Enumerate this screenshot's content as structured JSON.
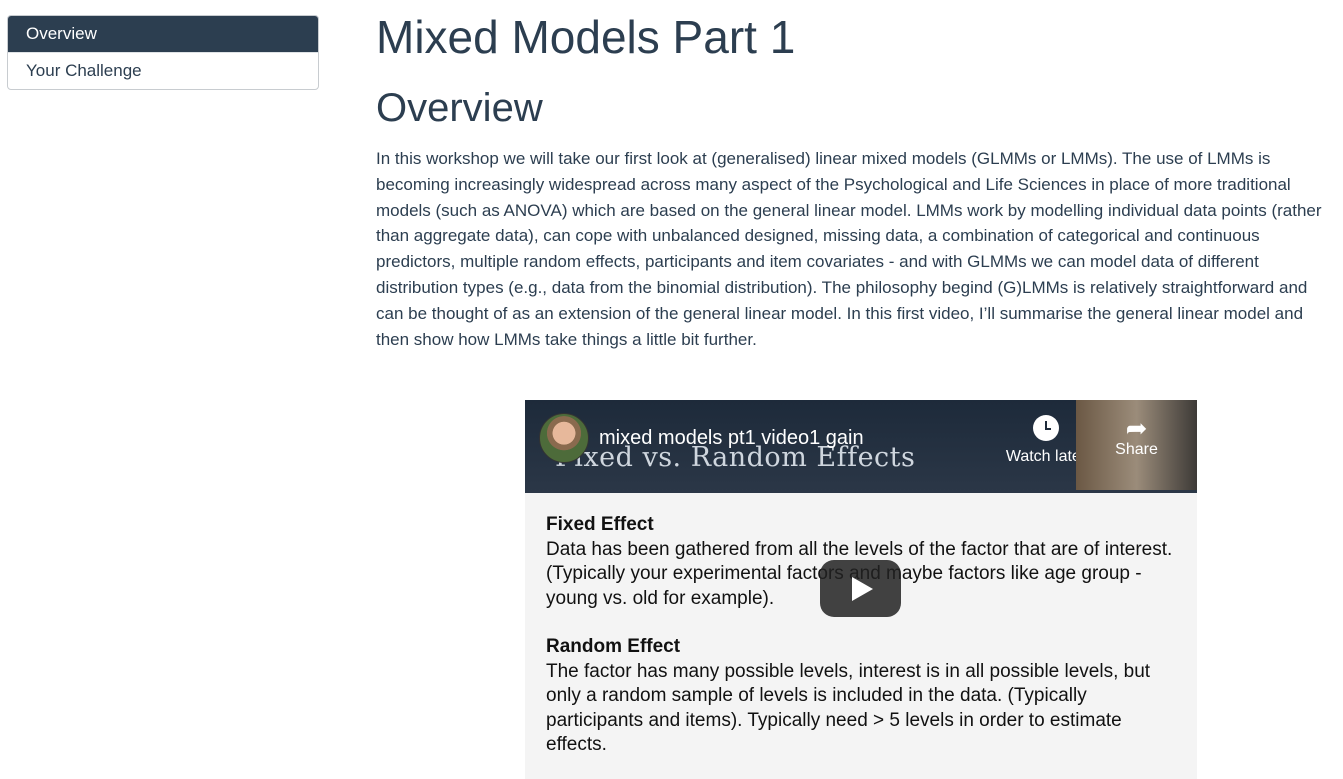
{
  "toc": {
    "items": [
      {
        "label": "Overview",
        "active": true
      },
      {
        "label": "Your Challenge",
        "active": false
      }
    ]
  },
  "main": {
    "page_title": "Mixed Models Part 1",
    "section_title": "Overview",
    "intro": "In this workshop we will take our first look at (generalised) linear mixed models (GLMMs or LMMs). The use of LMMs is becoming increasingly widespread across many aspect of the Psychological and Life Sciences in place of more traditional models (such as ANOVA) which are based on the general linear model. LMMs work by modelling individual data points (rather than aggregate data), can cope with unbalanced designed, missing data, a combination of categorical and continuous predictors, multiple random effects, participants and item covariates - and with GLMMs we can model data of different distribution types (e.g., data from the binomial distribution). The philosophy begind (G)LMMs is relatively straightforward and can be thought of as an extension of the general linear model. In this first video, I’ll summarise the general linear model and then show how LMMs take things a little bit further."
  },
  "video": {
    "title": "mixed models pt1 video1 gain",
    "watch_later_label": "Watch later",
    "share_label": "Share",
    "slide_heading": "Fixed vs. Random Effects",
    "fixed_heading": "Fixed Effect",
    "fixed_text": "Data has been gathered from all the levels of the factor that are of interest. (Typically your experimental factors and maybe factors like age group - young vs. old for example).",
    "random_heading": "Random Effect",
    "random_text": "The factor has many possible levels, interest is in all possible levels, but only a random sample of levels is included in the data. (Typically participants and items). Typically need > 5 levels in order to estimate effects.",
    "icons": {
      "watch_later": "clock-icon",
      "share": "share-arrow-icon",
      "play": "play-icon"
    }
  }
}
